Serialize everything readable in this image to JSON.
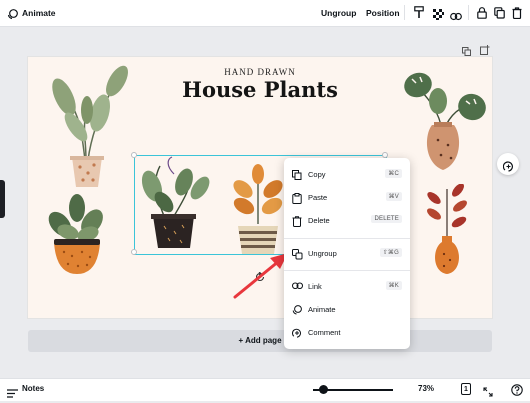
{
  "toolbar": {
    "animate_label": "Animate",
    "ungroup_label": "Ungroup",
    "position_label": "Position"
  },
  "design": {
    "subtitle": "HAND DRAWN",
    "title": "House Plants"
  },
  "context_menu": {
    "items": [
      {
        "label": "Copy",
        "shortcut": "⌘C",
        "icon": "copy-icon"
      },
      {
        "label": "Paste",
        "shortcut": "⌘V",
        "icon": "paste-icon"
      },
      {
        "label": "Delete",
        "shortcut": "DELETE",
        "icon": "trash-icon"
      },
      {
        "label": "Ungroup",
        "shortcut": "⇧⌘G",
        "icon": "ungroup-icon"
      },
      {
        "label": "Link",
        "shortcut": "⌘K",
        "icon": "link-icon"
      },
      {
        "label": "Animate",
        "shortcut": "",
        "icon": "animate-icon"
      },
      {
        "label": "Comment",
        "shortcut": "",
        "icon": "comment-icon"
      }
    ]
  },
  "add_page_label": "+ Add page",
  "bottom_bar": {
    "notes_label": "Notes",
    "zoom": "73%",
    "zoom_level_fraction": 0.12,
    "page_number": "1"
  },
  "colors": {
    "selection": "#3bc4d8",
    "arrow": "#e8373d",
    "canvas": "#fdf5ef"
  }
}
